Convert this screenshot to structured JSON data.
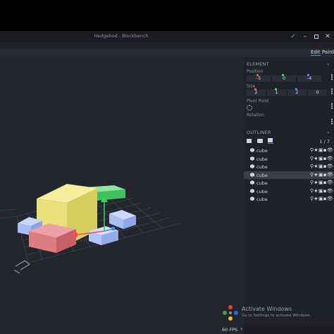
{
  "window": {
    "title": "Hedgehod - Blockbench"
  },
  "mode_tabs": [
    {
      "label": "Edit"
    },
    {
      "label": "Paint"
    }
  ],
  "element_panel": {
    "header": "ELEMENT",
    "position_label": "Position",
    "position": [
      "-5",
      "0",
      "-4"
    ],
    "size_label": "Size",
    "size": [
      "2",
      "1",
      "2",
      "0"
    ],
    "pivot_label": "Pivot Point",
    "rotation_label": "Rotation"
  },
  "outliner": {
    "header": "OUTLINER",
    "count": "1 / 7",
    "items": [
      {
        "name": "cube"
      },
      {
        "name": "cube"
      },
      {
        "name": "cube"
      },
      {
        "name": "cube"
      },
      {
        "name": "cube"
      },
      {
        "name": "cube"
      },
      {
        "name": "cube"
      }
    ],
    "selected_index": 3
  },
  "status": {
    "fps": "60 FPS"
  },
  "watermark": {
    "title": "Activate Windows",
    "subtitle": "Go to Settings to activate Windows."
  },
  "colors": {
    "x_axis": "#ff4d4d",
    "y_axis": "#33d15a",
    "z_axis": "#3d8bff",
    "accent": "#4c8dff",
    "viewport_bg": "#23262c",
    "panel_bg": "#1f2228"
  }
}
